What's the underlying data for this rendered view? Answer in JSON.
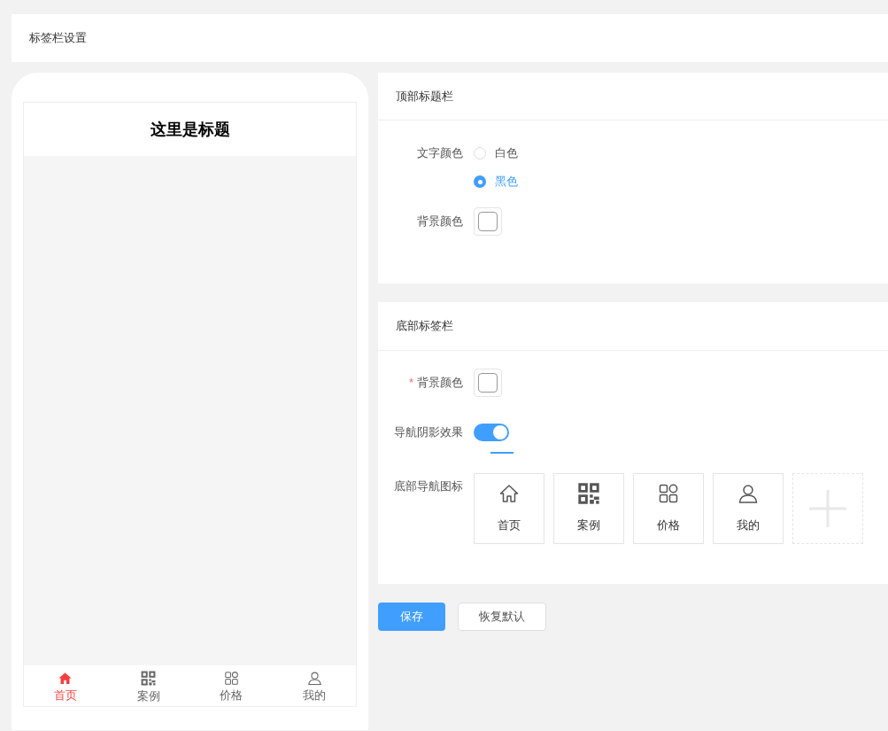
{
  "page_title": "标签栏设置",
  "preview": {
    "title": "这里是标题",
    "tabbar": [
      {
        "kind": "home",
        "label": "首页",
        "selected": true
      },
      {
        "kind": "qr",
        "label": "案例",
        "selected": false
      },
      {
        "kind": "grid",
        "label": "价格",
        "selected": false
      },
      {
        "kind": "user",
        "label": "我的",
        "selected": false
      }
    ]
  },
  "top_section": {
    "title": "顶部标题栏",
    "text_color": {
      "label": "文字颜色",
      "options": [
        {
          "label": "白色",
          "selected": false
        },
        {
          "label": "黑色",
          "selected": true
        }
      ]
    },
    "background": {
      "label": "背景颜色"
    }
  },
  "bottom_section": {
    "title": "底部标签栏",
    "background": {
      "label": "背景颜色",
      "required_mark": "*"
    },
    "shadow": {
      "label": "导航阴影效果",
      "on": true
    },
    "nav_icons": {
      "label": "底部导航图标",
      "items": [
        {
          "kind": "home",
          "label": "首页"
        },
        {
          "kind": "qr",
          "label": "案例"
        },
        {
          "kind": "grid",
          "label": "价格"
        },
        {
          "kind": "user",
          "label": "我的"
        }
      ]
    }
  },
  "buttons": [
    {
      "label": "保存",
      "kind": "primary"
    },
    {
      "label": "恢复默认",
      "kind": "default"
    }
  ]
}
